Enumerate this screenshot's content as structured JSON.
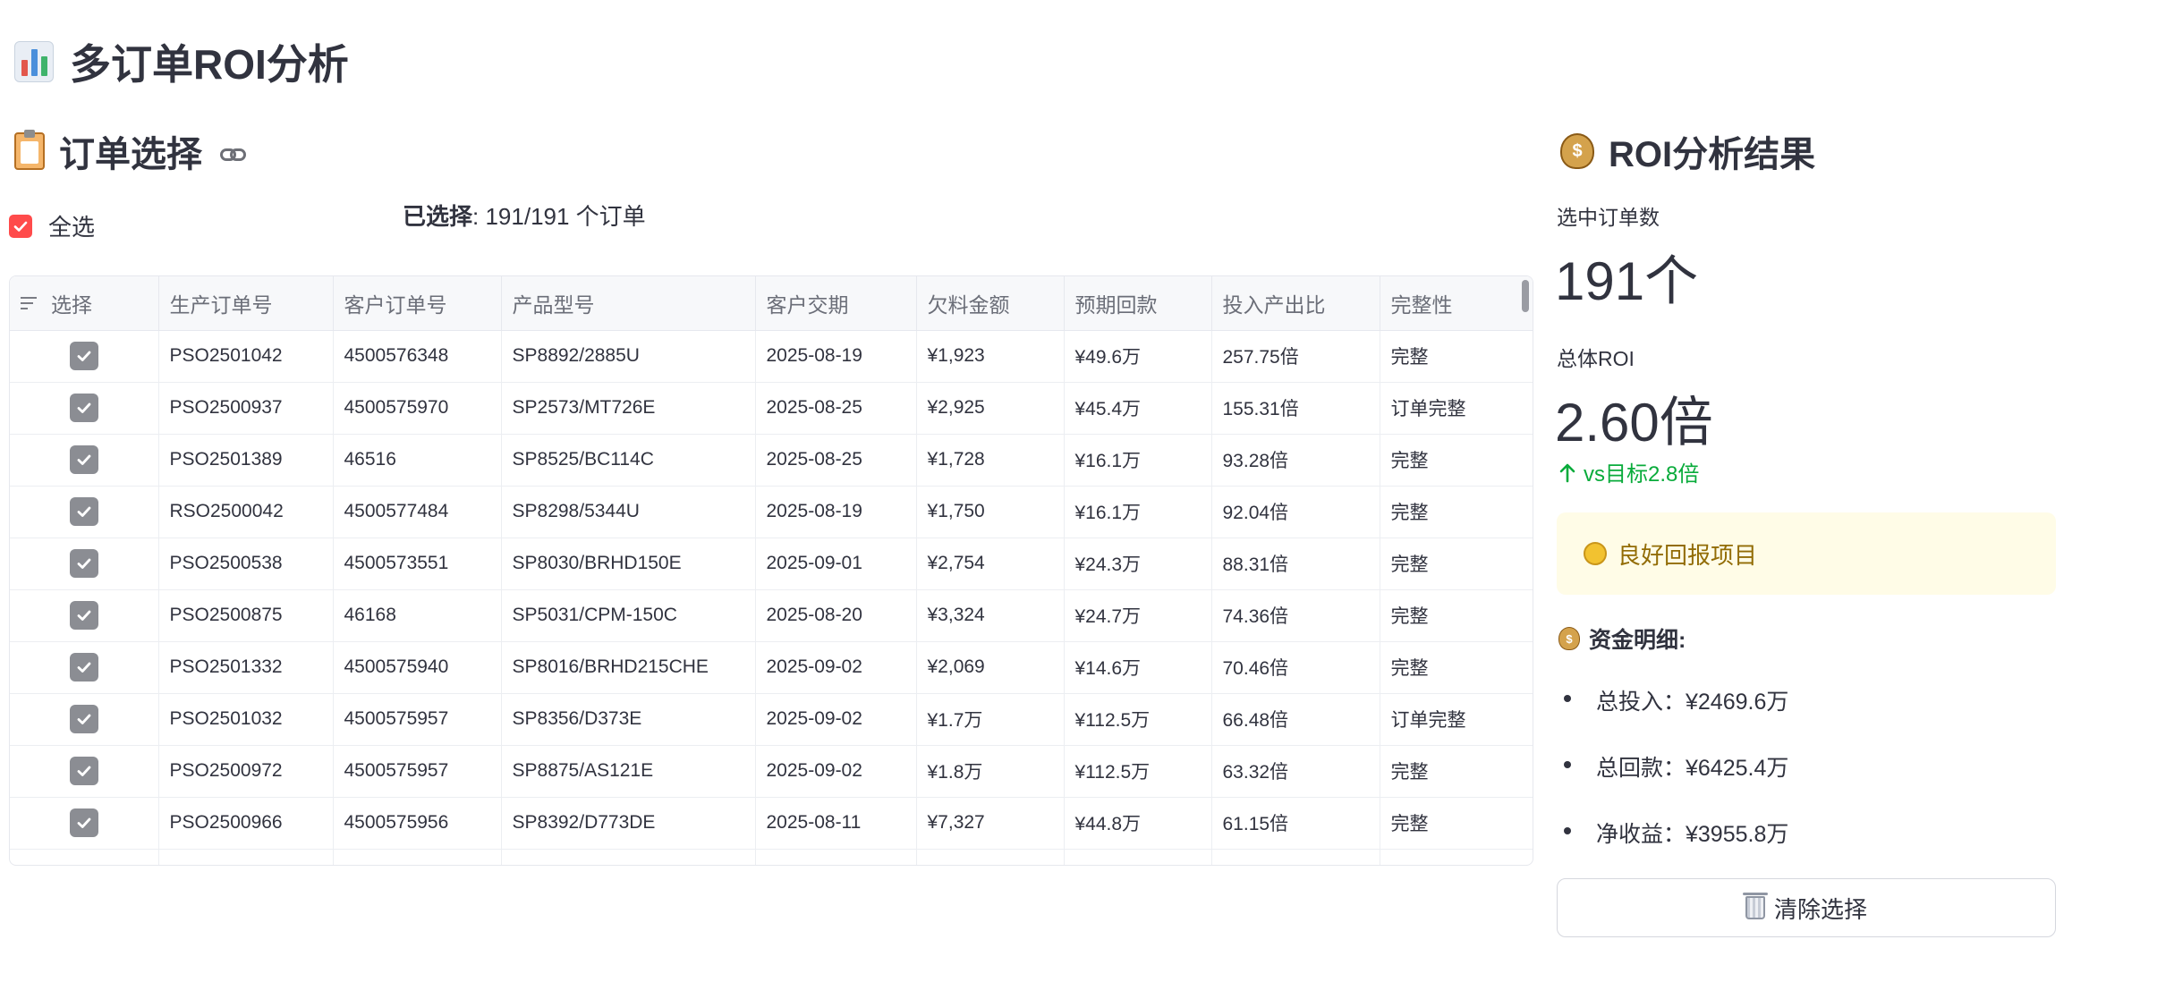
{
  "page": {
    "title": "多订单ROI分析",
    "title_icon": "bar-chart-emoji"
  },
  "order_section": {
    "title": "订单选择",
    "title_icon": "clipboard-emoji",
    "link_icon": "link-icon"
  },
  "select_all": {
    "label": "全选",
    "checked": true
  },
  "selected_info": {
    "label": "已选择",
    "value": ": 191/191 个订单"
  },
  "table": {
    "columns": [
      "选择",
      "生产订单号",
      "客户订单号",
      "产品型号",
      "客户交期",
      "欠料金额",
      "预期回款",
      "投入产出比",
      "完整性"
    ],
    "rows": [
      {
        "po": "PSO2501042",
        "co": "4500576348",
        "model": "SP8892/2885U",
        "date": "2025-08-19",
        "short": "¥1,923",
        "ret": "¥49.6万",
        "roi": "257.75倍",
        "status": "完整"
      },
      {
        "po": "PSO2500937",
        "co": "4500575970",
        "model": "SP2573/MT726E",
        "date": "2025-08-25",
        "short": "¥2,925",
        "ret": "¥45.4万",
        "roi": "155.31倍",
        "status": "订单完整"
      },
      {
        "po": "PSO2501389",
        "co": "46516",
        "model": "SP8525/BC114C",
        "date": "2025-08-25",
        "short": "¥1,728",
        "ret": "¥16.1万",
        "roi": "93.28倍",
        "status": "完整"
      },
      {
        "po": "RSO2500042",
        "co": "4500577484",
        "model": "SP8298/5344U",
        "date": "2025-08-19",
        "short": "¥1,750",
        "ret": "¥16.1万",
        "roi": "92.04倍",
        "status": "完整"
      },
      {
        "po": "PSO2500538",
        "co": "4500573551",
        "model": "SP8030/BRHD150E",
        "date": "2025-09-01",
        "short": "¥2,754",
        "ret": "¥24.3万",
        "roi": "88.31倍",
        "status": "完整"
      },
      {
        "po": "PSO2500875",
        "co": "46168",
        "model": "SP5031/CPM-150C",
        "date": "2025-08-20",
        "short": "¥3,324",
        "ret": "¥24.7万",
        "roi": "74.36倍",
        "status": "完整"
      },
      {
        "po": "PSO2501332",
        "co": "4500575940",
        "model": "SP8016/BRHD215CHE",
        "date": "2025-09-02",
        "short": "¥2,069",
        "ret": "¥14.6万",
        "roi": "70.46倍",
        "status": "完整"
      },
      {
        "po": "PSO2501032",
        "co": "4500575957",
        "model": "SP8356/D373E",
        "date": "2025-09-02",
        "short": "¥1.7万",
        "ret": "¥112.5万",
        "roi": "66.48倍",
        "status": "订单完整"
      },
      {
        "po": "PSO2500972",
        "co": "4500575957",
        "model": "SP8875/AS121E",
        "date": "2025-09-02",
        "short": "¥1.8万",
        "ret": "¥112.5万",
        "roi": "63.32倍",
        "status": "完整"
      },
      {
        "po": "PSO2500966",
        "co": "4500575956",
        "model": "SP8392/D773DE",
        "date": "2025-08-11",
        "short": "¥7,327",
        "ret": "¥44.8万",
        "roi": "61.15倍",
        "status": "完整"
      }
    ]
  },
  "roi_section": {
    "title": "ROI分析结果",
    "title_icon": "money-bag-emoji",
    "selected_count_label": "选中订单数",
    "selected_count_value": "191个",
    "total_roi_label": "总体ROI",
    "total_roi_value": "2.60倍",
    "delta": "vs目标2.8倍",
    "delta_icon": "arrow-up-icon",
    "alert_text": "良好回报项目",
    "alert_icon": "coin-emoji",
    "details_title": "资金明细:",
    "details": [
      "总投入：¥2469.6万",
      "总回款：¥6425.4万",
      "净收益：¥3955.8万"
    ],
    "clear_button": "清除选择",
    "clear_icon": "wastebasket-emoji"
  },
  "colors": {
    "accent": "#ff4b4b",
    "delta_green": "#09ab3b",
    "alert_bg": "#fffce7",
    "alert_text": "#926c05"
  }
}
